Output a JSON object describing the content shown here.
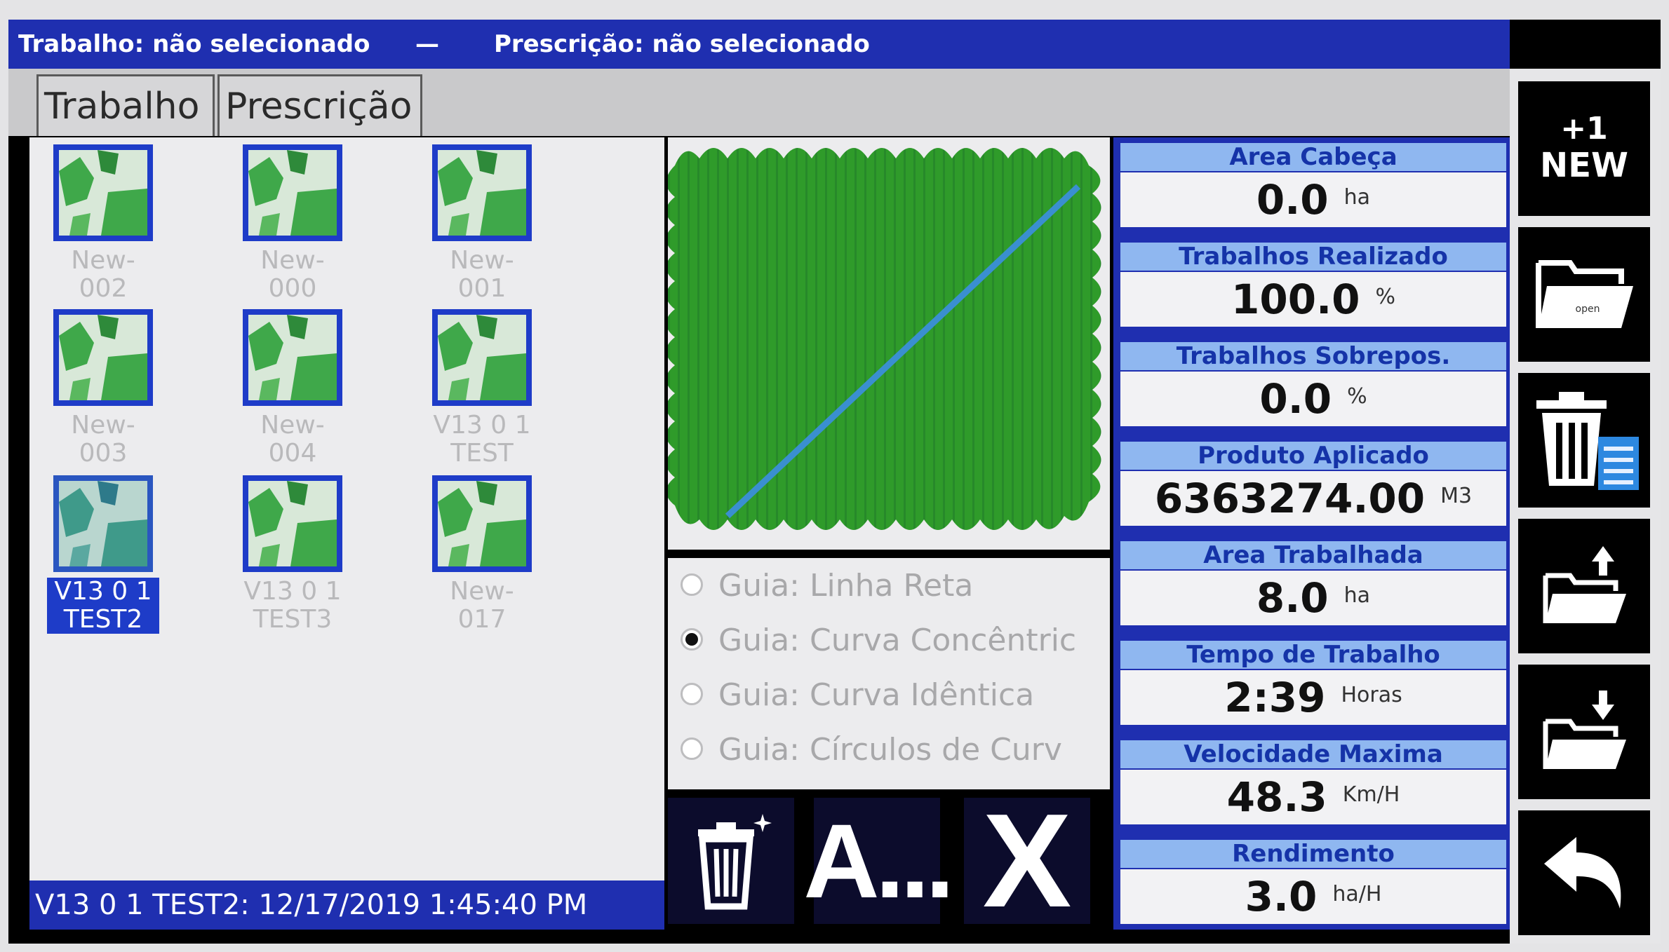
{
  "titlebar": {
    "job": "Trabalho: não selecionado",
    "separator": "—",
    "prescription": "Prescrição: não selecionado"
  },
  "tabs": [
    {
      "label": "Trabalho",
      "active": true
    },
    {
      "label": "Prescrição",
      "active": false
    }
  ],
  "jobs": [
    {
      "label": "New-002",
      "selected": false
    },
    {
      "label": "New-000",
      "selected": false
    },
    {
      "label": "New-001",
      "selected": false
    },
    {
      "label": "New-003",
      "selected": false
    },
    {
      "label": "New-004",
      "selected": false
    },
    {
      "label": "V13 0 1 TEST",
      "selected": false
    },
    {
      "label": "V13 0 1 TEST2",
      "selected": true
    },
    {
      "label": "V13 0 1 TEST3",
      "selected": false
    },
    {
      "label": "New-017",
      "selected": false
    }
  ],
  "status": "V13 0 1 TEST2: 12/17/2019 1:45:40 PM",
  "guides": [
    {
      "label": "Guia: Linha Reta",
      "selected": false
    },
    {
      "label": "Guia: Curva Concêntric",
      "selected": true
    },
    {
      "label": "Guia: Curva Idêntica",
      "selected": false
    },
    {
      "label": "Guia: Círculos de Curv",
      "selected": false
    }
  ],
  "stats": [
    {
      "label": "Area Cabeça",
      "value": "0.0",
      "unit": "ha"
    },
    {
      "label": "Trabalhos Realizado",
      "value": "100.0",
      "unit": "%"
    },
    {
      "label": "Trabalhos Sobrepos.",
      "value": "0.0",
      "unit": "%"
    },
    {
      "label": "Produto Aplicado",
      "value": "6363274.00",
      "unit": "M3"
    },
    {
      "label": "Area Trabalhada",
      "value": "8.0",
      "unit": "ha"
    },
    {
      "label": "Tempo de Trabalho",
      "value": "2:39",
      "unit": "Horas"
    },
    {
      "label": "Velocidade Maxima",
      "value": "48.3",
      "unit": "Km/H"
    },
    {
      "label": "Rendimento",
      "value": "3.0",
      "unit": "ha/H"
    }
  ],
  "buttons": {
    "rename_label": "A...",
    "close_label": "X",
    "new_line1": "+1",
    "new_line2": "NEW",
    "open_caption": "open"
  },
  "colors": {
    "title_blue": "#1f2fb0",
    "stat_header": "#8fb7f0",
    "field_green": "#2a9a26",
    "path_blue": "#3a8fd0"
  }
}
